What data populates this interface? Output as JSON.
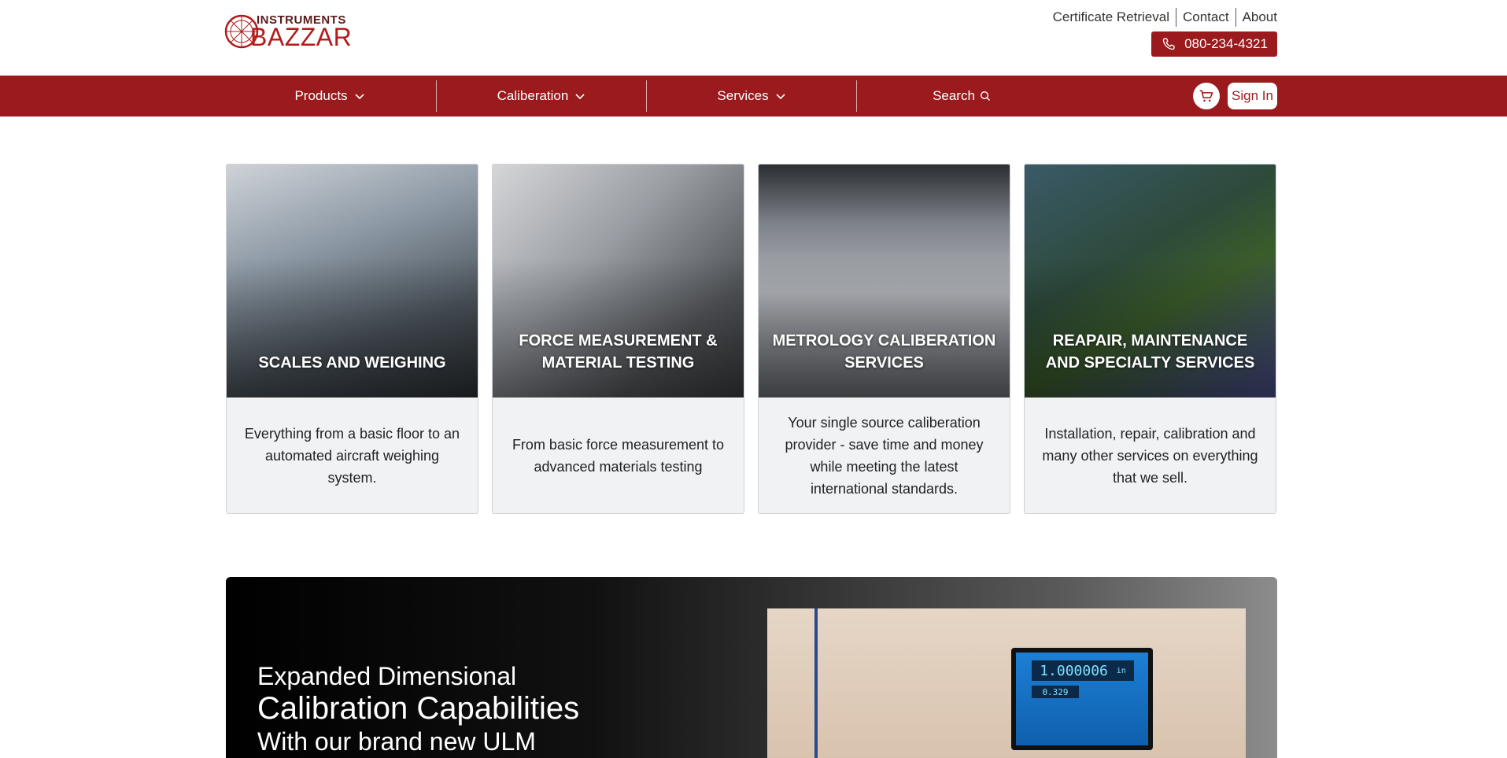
{
  "brand": {
    "line1": "INSTRUMENTS",
    "line2": "BAZZAR"
  },
  "top_links": [
    "Certificate Retrieval",
    "Contact",
    "About"
  ],
  "phone": "080-234-4321",
  "nav": {
    "items": [
      {
        "label": "Products",
        "icon": "chevron-down-icon"
      },
      {
        "label": "Caliberation",
        "icon": "chevron-down-icon"
      },
      {
        "label": "Services",
        "icon": "chevron-down-icon"
      },
      {
        "label": "Search",
        "icon": "search-icon"
      }
    ],
    "sign_in": "Sign In",
    "cart_icon": "cart-icon"
  },
  "cards": [
    {
      "title": "SCALES AND WEIGHING",
      "description": "Everything from a basic floor to an automated aircraft weighing system."
    },
    {
      "title": "FORCE MEASUREMENT & MATERIAL TESTING",
      "description": "From basic force measurement to advanced materials testing"
    },
    {
      "title": "METROLOGY CALIBERATION SERVICES",
      "description": "Your single source caliberation provider - save time and money while meeting the latest international standards."
    },
    {
      "title": "REAPAIR, MAINTENANCE AND SPECIALTY SERVICES",
      "description": "Installation, repair, calibration and many other services on everything that we sell."
    }
  ],
  "banner": {
    "line1": "Expanded Dimensional",
    "line2": "Calibration Capabilities",
    "line3": "With our brand new ULM",
    "screen_reading": "1.000006",
    "screen_unit": "in",
    "screen_small": "0.329"
  },
  "colors": {
    "brand_red": "#9a1a1d",
    "card_bg": "#f0f2f4"
  }
}
